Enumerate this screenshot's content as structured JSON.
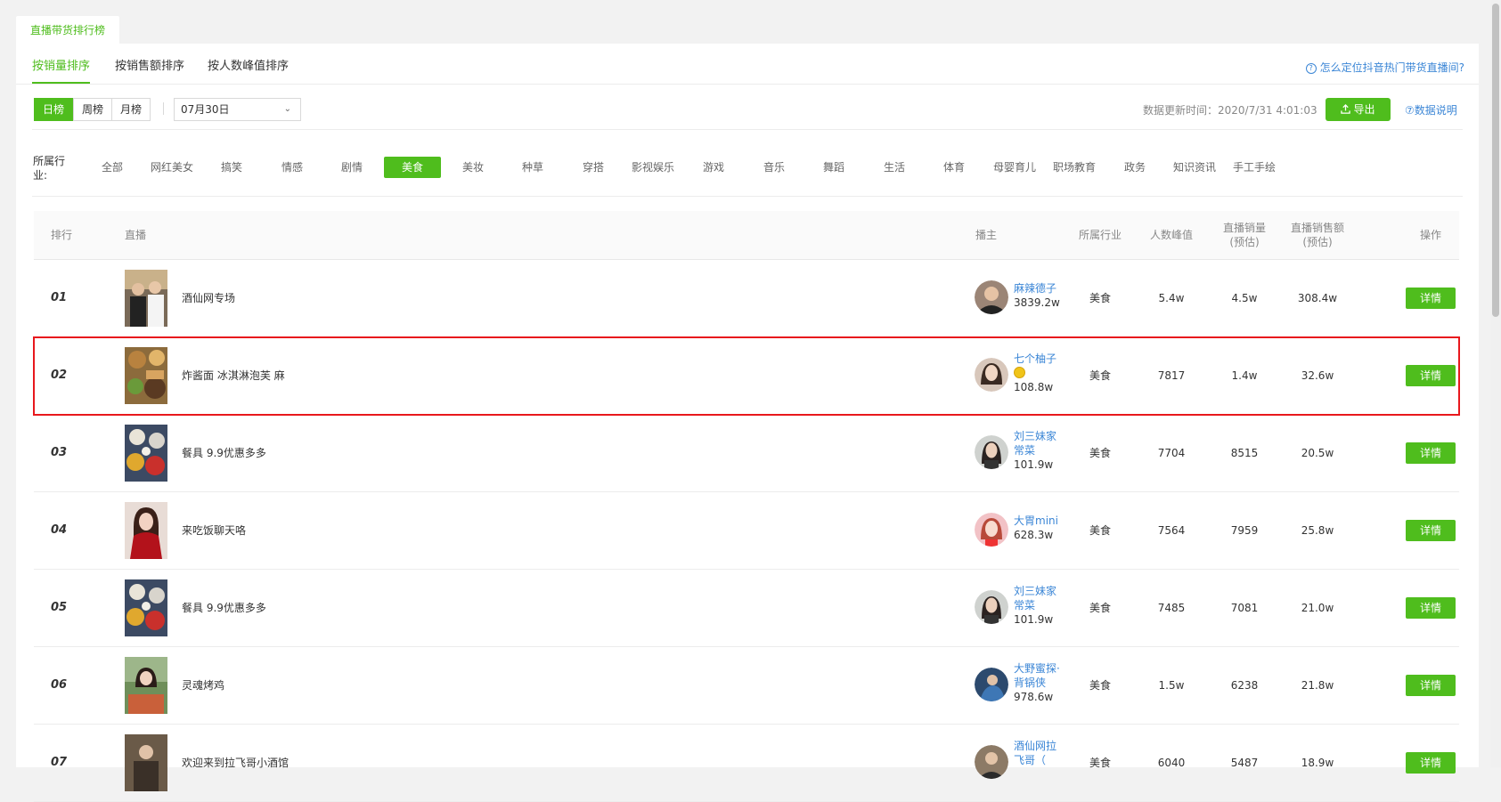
{
  "page_tab": "直播带货排行榜",
  "sort_tabs": [
    "按销量排序",
    "按销售额排序",
    "按人数峰值排序"
  ],
  "help_link": "怎么定位抖音热门带货直播间?",
  "period_buttons": [
    "日榜",
    "周榜",
    "月榜"
  ],
  "date_value": "07月30日",
  "update_time": "数据更新时间：2020/7/31 4:01:03",
  "export_label": "导出",
  "data_note": "⑦数据说明",
  "category_label": "所属行业:",
  "categories": [
    "全部",
    "网红美女",
    "搞笑",
    "情感",
    "剧情",
    "美食",
    "美妆",
    "种草",
    "穿搭",
    "影视娱乐",
    "游戏",
    "音乐",
    "舞蹈",
    "生活",
    "体育",
    "母婴育儿",
    "职场教育",
    "政务",
    "知识资讯",
    "手工手绘"
  ],
  "active_category": "美食",
  "columns": {
    "rank": "排行",
    "live": "直播",
    "host": "播主",
    "industry": "所属行业",
    "peak": "人数峰值",
    "sales": "直播销量(预估)",
    "revenue": "直播销售额(预估)",
    "action": "操作"
  },
  "detail_label": "详情",
  "rows": [
    {
      "rank": "01",
      "title": "酒仙网专场",
      "host": "麻辣德子",
      "fans": "3839.2w",
      "industry": "美食",
      "peak": "5.4w",
      "sales": "4.5w",
      "revenue": "308.4w"
    },
    {
      "rank": "02",
      "title": "炸酱面 冰淇淋泡芙 麻",
      "host": "七个柚子",
      "fans": "108.8w",
      "industry": "美食",
      "peak": "7817",
      "sales": "1.4w",
      "revenue": "32.6w"
    },
    {
      "rank": "03",
      "title": "餐具 9.9优惠多多",
      "host": "刘三妹家常菜",
      "fans": "101.9w",
      "industry": "美食",
      "peak": "7704",
      "sales": "8515",
      "revenue": "20.5w"
    },
    {
      "rank": "04",
      "title": "来吃饭聊天咯",
      "host": "大胃mini",
      "fans": "628.3w",
      "industry": "美食",
      "peak": "7564",
      "sales": "7959",
      "revenue": "25.8w"
    },
    {
      "rank": "05",
      "title": "餐具 9.9优惠多多",
      "host": "刘三妹家常菜",
      "fans": "101.9w",
      "industry": "美食",
      "peak": "7485",
      "sales": "7081",
      "revenue": "21.0w"
    },
    {
      "rank": "06",
      "title": "灵魂烤鸡",
      "host": "大野蜜探·背锅侠",
      "fans": "978.6w",
      "industry": "美食",
      "peak": "1.5w",
      "sales": "6238",
      "revenue": "21.8w"
    },
    {
      "rank": "07",
      "title": "欢迎来到拉飞哥小酒馆",
      "host": "酒仙网拉飞哥（",
      "fans": "",
      "industry": "美食",
      "peak": "6040",
      "sales": "5487",
      "revenue": "18.9w"
    }
  ]
}
